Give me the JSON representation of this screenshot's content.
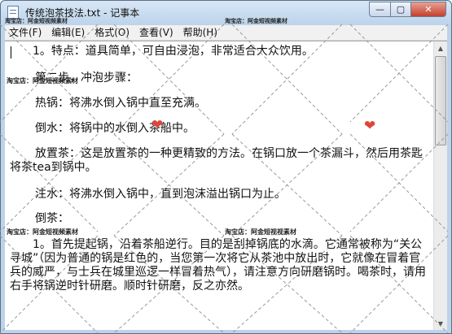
{
  "window": {
    "title": "传统泡茶技法.txt - 记事本",
    "controls": {
      "minimize": "—",
      "maximize": "▢",
      "close": "✕"
    }
  },
  "menu": {
    "items": [
      "文件(F)",
      "编辑(E)",
      "格式(O)",
      "查看(V)",
      "帮助(H)"
    ]
  },
  "document": {
    "paragraphs": [
      "1。特点：道具简单，可自由浸泡，非常适合大众饮用。",
      "第二步，冲泡步骤：",
      "热锅：将沸水倒入锅中直至充满。",
      "倒水：将锅中的水倒入茶船中。",
      "放置茶：这是放置茶的一种更精致的方法。在锅口放一个茶漏斗，然后用茶匙将茶tea到锅中。",
      "注水：将沸水倒入锅中，直到泡沫溢出锅口为止。",
      "倒茶：",
      "1。首先提起锅，沿着茶船逆行。目的是刮掉锅底的水滴。它通常被称为“关公寻城”（因为普通的锅是红色的，当您第一次将它从茶池中放出时，它就像在冒着官兵的威严，与士兵在城里巡逻一样冒着热气），请注意方向研磨锅时。喝茶时，请用右手将锅逆时针研磨。顺时针研磨，反之亦然。"
    ]
  },
  "watermark": {
    "label": "淘宝店：阿金短视频素材",
    "label_variant": "淘宝店：阿金短视视素材"
  },
  "decor": {
    "heart_icon": "❤",
    "accent_color": "#e0443b"
  }
}
